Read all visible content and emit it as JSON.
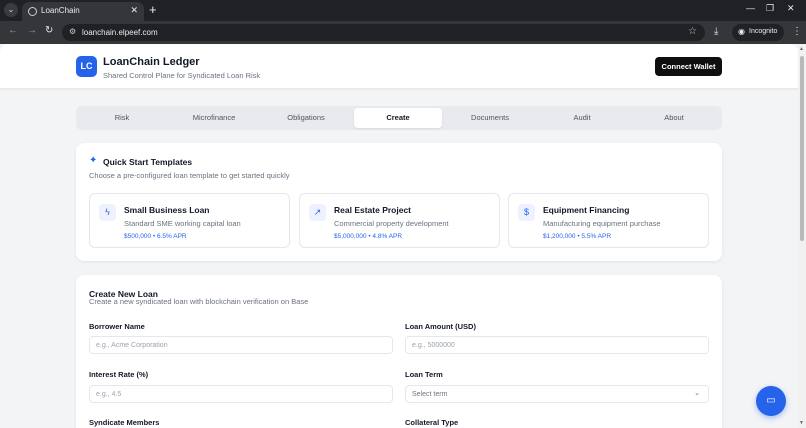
{
  "browser": {
    "tab_title": "LoanChain",
    "url": "loanchain.elpeef.com",
    "incognito_label": "Incognito",
    "icons": {
      "tab_menu": "chevron-down-icon",
      "favicon": "globe-icon",
      "tab_close": "close-icon",
      "new_tab": "plus-icon",
      "back": "arrow-left-icon",
      "forward": "arrow-right-icon",
      "reload": "reload-icon",
      "site_info": "tune-icon",
      "bookmark": "star-icon",
      "download": "download-icon",
      "incognito": "incognito-icon",
      "menu": "kebab-icon"
    }
  },
  "header": {
    "logo_text": "LC",
    "title": "LoanChain Ledger",
    "subtitle": "Shared Control Plane for Syndicated Loan Risk",
    "connect_label": "Connect Wallet"
  },
  "nav": {
    "tabs": [
      {
        "label": "Risk"
      },
      {
        "label": "Microfinance"
      },
      {
        "label": "Obligations"
      },
      {
        "label": "Create",
        "active": true
      },
      {
        "label": "Documents"
      },
      {
        "label": "Audit"
      },
      {
        "label": "About"
      }
    ]
  },
  "quick_start": {
    "title": "Quick Start Templates",
    "subtitle": "Choose a pre-configured loan template to get started quickly",
    "templates": [
      {
        "title": "Small Business Loan",
        "desc": "Standard SME working capital loan",
        "meta": "$500,000 • 6.5% APR",
        "icon": "lightning-icon"
      },
      {
        "title": "Real Estate Project",
        "desc": "Commercial property development",
        "meta": "$5,000,000 • 4.8% APR",
        "icon": "trending-up-icon"
      },
      {
        "title": "Equipment Financing",
        "desc": "Manufacturing equipment purchase",
        "meta": "$1,200,000 • 5.5% APR",
        "icon": "dollar-icon"
      }
    ]
  },
  "form": {
    "title": "Create New Loan",
    "subtitle": "Create a new syndicated loan with blockchain verification on Base",
    "borrower_label": "Borrower Name",
    "borrower_placeholder": "e.g., Acme Corporation",
    "amount_label": "Loan Amount (USD)",
    "amount_placeholder": "e.g., 5000000",
    "rate_label": "Interest Rate (%)",
    "rate_placeholder": "e.g., 4.5",
    "term_label": "Loan Term",
    "term_placeholder": "Select term",
    "syndicate_label": "Syndicate Members",
    "collateral_label": "Collateral Type"
  },
  "colors": {
    "accent": "#2563eb",
    "dark_button": "#0f0f10",
    "page_bg": "#f3f4f6"
  }
}
